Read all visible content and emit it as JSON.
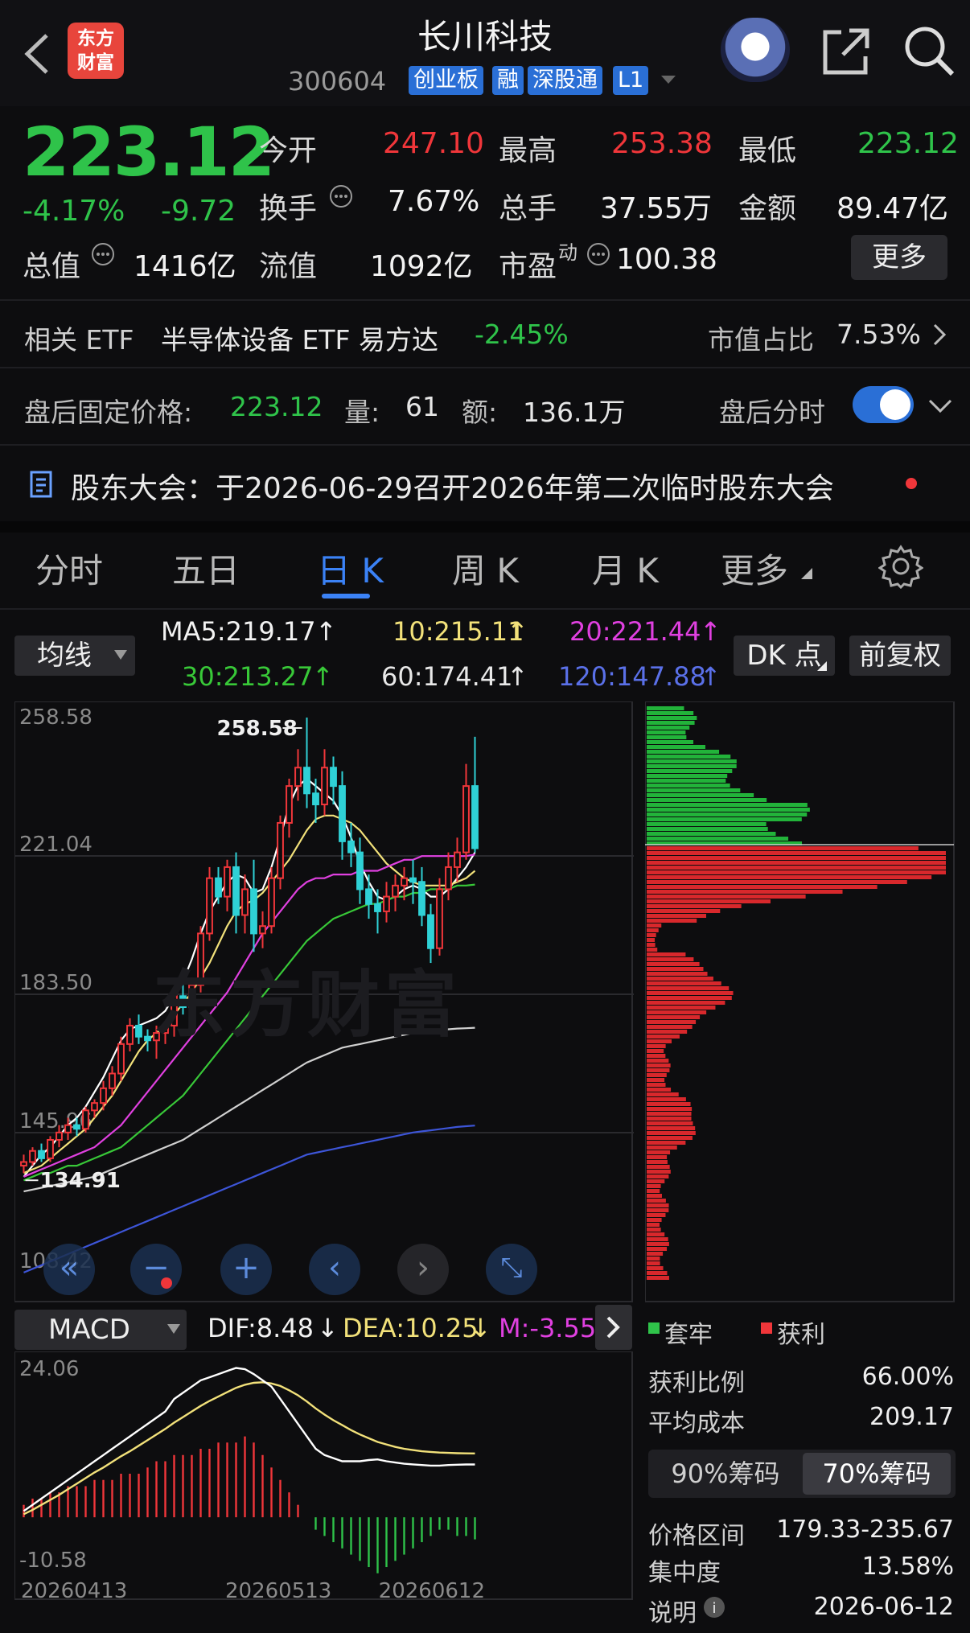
{
  "header": {
    "logo_text_line1": "东方",
    "logo_text_line2": "财富",
    "stock_name": "长川科技",
    "stock_code": "300604",
    "tags": [
      "创业板",
      "融",
      "深股通",
      "L1"
    ]
  },
  "quote": {
    "price": "223.12",
    "change_pct": "-4.17%",
    "change_abs": "-9.72",
    "open_label": "今开",
    "open": "247.10",
    "high_label": "最高",
    "high": "253.38",
    "low_label": "最低",
    "low": "223.12",
    "turnover_label": "换手",
    "turnover": "7.67%",
    "volume_label": "总手",
    "volume": "37.55万",
    "amount_label": "金额",
    "amount": "89.47亿",
    "mktcap_label": "总值",
    "mktcap": "1416亿",
    "float_label": "流值",
    "float": "1092亿",
    "pe_label": "市盈",
    "pe_sup": "动",
    "pe": "100.38",
    "more_label": "更多"
  },
  "etf": {
    "label": "相关 ETF",
    "name": "半导体设备 ETF 易方达",
    "change": "-2.45%",
    "ratio_label": "市值占比",
    "ratio": "7.53%"
  },
  "after_hours": {
    "price_label": "盘后固定价格:",
    "price": "223.12",
    "vol_label": "量:",
    "vol": "61",
    "amt_label": "额:",
    "amt": "136.1万",
    "toggle_label": "盘后分时"
  },
  "notice": {
    "text": "股东大会：于2026-06-29召开2026年第二次临时股东大会"
  },
  "tabs": [
    "分时",
    "五日",
    "日 K",
    "周 K",
    "月 K",
    "更多"
  ],
  "ma_bar": {
    "selector": "均线",
    "ma5": "MA5:219.17",
    "ma10": "10:215.11",
    "ma20": "20:221.44",
    "ma30": "30:213.27",
    "ma60": "60:174.41",
    "ma120": "120:147.88",
    "dk_label": "DK 点",
    "adjust_label": "前复权"
  },
  "colors": {
    "up": "#f0363a",
    "down": "#2fd1d6",
    "ma5": "#ffffff",
    "ma10": "#f2e17a",
    "ma20": "#e040e0",
    "ma30": "#38c838",
    "ma60": "#d0d0d0",
    "ma120": "#3d55d8",
    "accent": "#3b82f6"
  },
  "chart_data": {
    "type": "candlestick",
    "watermark": "东方财富",
    "y_axis_labels": [
      "258.58",
      "221.04",
      "183.50",
      "145.96",
      "108.42"
    ],
    "ylim": [
      108.42,
      258.58
    ],
    "max_marker": "258.58",
    "min_marker": "134.91",
    "x_labels": [
      "20260413",
      "20260513",
      "20260612"
    ],
    "candles": [
      [
        137,
        138,
        135,
        140
      ],
      [
        138,
        141,
        137,
        142
      ],
      [
        141,
        139,
        138,
        143
      ],
      [
        139,
        144,
        138,
        145
      ],
      [
        144,
        146,
        142,
        148
      ],
      [
        146,
        148,
        144,
        150
      ],
      [
        148,
        147,
        145,
        150
      ],
      [
        147,
        152,
        146,
        153
      ],
      [
        152,
        154,
        150,
        155
      ],
      [
        154,
        158,
        152,
        160
      ],
      [
        158,
        162,
        156,
        164
      ],
      [
        162,
        170,
        160,
        172
      ],
      [
        170,
        175,
        168,
        177
      ],
      [
        175,
        172,
        170,
        178
      ],
      [
        172,
        171,
        168,
        174
      ],
      [
        171,
        173,
        166,
        175
      ],
      [
        173,
        175,
        170,
        176
      ],
      [
        175,
        183,
        172,
        184
      ],
      [
        183,
        180,
        178,
        186
      ],
      [
        180,
        186,
        178,
        188
      ],
      [
        186,
        200,
        184,
        202
      ],
      [
        200,
        215,
        198,
        218
      ],
      [
        215,
        210,
        208,
        218
      ],
      [
        210,
        218,
        206,
        220
      ],
      [
        218,
        205,
        200,
        222
      ],
      [
        205,
        212,
        200,
        216
      ],
      [
        212,
        200,
        195,
        220
      ],
      [
        200,
        202,
        196,
        206
      ],
      [
        202,
        215,
        200,
        218
      ],
      [
        215,
        230,
        212,
        232
      ],
      [
        230,
        240,
        226,
        242
      ],
      [
        240,
        245,
        236,
        250
      ],
      [
        245,
        238,
        234,
        258.58
      ],
      [
        238,
        235,
        230,
        242
      ],
      [
        235,
        245,
        232,
        250
      ],
      [
        245,
        240,
        235,
        248
      ],
      [
        240,
        225,
        220,
        244
      ],
      [
        225,
        222,
        218,
        230
      ],
      [
        222,
        212,
        208,
        226
      ],
      [
        212,
        208,
        204,
        216
      ],
      [
        208,
        206,
        200,
        212
      ],
      [
        206,
        210,
        203,
        214
      ],
      [
        210,
        213,
        206,
        216
      ],
      [
        213,
        215,
        209,
        218
      ],
      [
        215,
        214,
        208,
        220
      ],
      [
        214,
        205,
        202,
        218
      ],
      [
        205,
        196,
        192,
        208
      ],
      [
        196,
        212,
        194,
        215
      ],
      [
        212,
        218,
        209,
        222
      ],
      [
        218,
        222,
        214,
        226
      ],
      [
        222,
        240,
        220,
        246
      ],
      [
        240,
        223.12,
        222,
        253.38
      ]
    ],
    "ma": {
      "MA5": [
        134,
        137,
        140,
        142,
        145,
        148,
        150,
        153,
        157,
        161,
        166,
        171,
        174,
        175,
        176,
        177,
        179,
        183,
        187,
        193,
        200,
        206,
        210,
        214,
        216,
        215,
        211,
        212,
        218,
        226,
        235,
        240,
        242,
        240,
        238,
        236,
        232,
        226,
        219,
        214,
        210,
        209,
        210,
        212,
        213,
        212,
        210,
        210,
        212,
        215,
        218,
        222
      ],
      "MA10": [
        135,
        136,
        137,
        139,
        141,
        143,
        145,
        147,
        150,
        153,
        156,
        160,
        164,
        168,
        171,
        173,
        175,
        178,
        181,
        184,
        188,
        192,
        197,
        202,
        206,
        208,
        209,
        211,
        214,
        217,
        220,
        224,
        228,
        231,
        232,
        232,
        231,
        230,
        228,
        225,
        222,
        219,
        217,
        215,
        214,
        213,
        213,
        213,
        213,
        214,
        215,
        217
      ],
      "MA20": [
        134,
        135,
        136,
        137,
        138,
        139,
        140,
        141,
        142,
        144,
        146,
        148,
        151,
        154,
        157,
        160,
        163,
        166,
        169,
        172,
        175,
        178,
        181,
        184,
        188,
        192,
        196,
        200,
        203,
        206,
        209,
        212,
        214,
        215,
        215,
        216,
        216,
        216,
        217,
        217,
        217,
        218,
        219,
        220,
        220,
        221,
        221,
        221,
        221,
        221,
        221,
        221.44
      ],
      "MA30": [
        133,
        134,
        135,
        135,
        136,
        137,
        137,
        138,
        139,
        140,
        141,
        142,
        144,
        146,
        148,
        150,
        152,
        154,
        156,
        159,
        162,
        165,
        168,
        171,
        174,
        177,
        180,
        183,
        186,
        189,
        192,
        195,
        198,
        200,
        202,
        204,
        205,
        206,
        207,
        208,
        208,
        209,
        210,
        210,
        211,
        211,
        212,
        212,
        212,
        213,
        213,
        213.27
      ],
      "MA60": [
        130,
        130.5,
        131,
        131.5,
        132,
        132.5,
        133,
        133.5,
        134,
        135,
        136,
        137,
        138,
        139,
        140,
        141,
        142,
        143,
        144,
        145.5,
        147,
        148.5,
        150,
        151.5,
        153,
        154.5,
        156,
        157.5,
        159,
        160.5,
        162,
        163.5,
        165,
        166,
        167,
        168,
        169,
        169.5,
        170,
        170.5,
        171,
        171.5,
        172,
        172.5,
        173,
        173.3,
        173.6,
        173.8,
        174,
        174.2,
        174.3,
        174.41
      ],
      "MA120": [
        108,
        109,
        110,
        111,
        112,
        113,
        114,
        115,
        116,
        117,
        118,
        119,
        120,
        121,
        122,
        123,
        124,
        125,
        126,
        127,
        128,
        129,
        130,
        131,
        132,
        133,
        134,
        135,
        136,
        137,
        138,
        139,
        140,
        140.5,
        141,
        141.5,
        142,
        142.5,
        143,
        143.5,
        144,
        144.5,
        145,
        145.5,
        146,
        146.3,
        146.6,
        146.9,
        147.2,
        147.5,
        147.7,
        147.88
      ]
    }
  },
  "macd": {
    "selector": "MACD",
    "dif": "DIF:8.48",
    "dea": "DEA:10.25",
    "m": "M:-3.55",
    "ylim": [
      -10.58,
      24.06
    ],
    "y_top": "24.06",
    "y_bottom": "-10.58",
    "hist": [
      2,
      3,
      3,
      4,
      4,
      5,
      5,
      5,
      6,
      6,
      6,
      7,
      7,
      7,
      8,
      9,
      9,
      10,
      10,
      10,
      11,
      11,
      12,
      12,
      12,
      13,
      12,
      10,
      8,
      6,
      4,
      2,
      0,
      -2,
      -3,
      -4,
      -5,
      -6,
      -7,
      -8,
      -9,
      -8,
      -7,
      -6,
      -5,
      -4,
      -3,
      -2,
      -2,
      -3,
      -3,
      -3.55
    ],
    "dif_line": [
      1,
      2,
      3,
      4,
      5,
      6,
      7,
      8,
      9,
      10,
      11,
      12,
      13,
      14,
      15,
      16,
      17,
      19,
      20,
      21,
      22,
      22.5,
      23,
      23.5,
      24,
      23.8,
      23,
      22,
      21,
      19,
      17,
      15,
      13,
      11,
      10,
      9.5,
      9,
      9,
      9,
      9.2,
      9.3,
      9,
      8.8,
      8.6,
      8.5,
      8.4,
      8.3,
      8.3,
      8.4,
      8.45,
      8.48,
      8.48
    ],
    "dea_line": [
      0.5,
      1.2,
      2,
      2.8,
      3.6,
      4.5,
      5.4,
      6.3,
      7.2,
      8,
      8.9,
      9.8,
      10.6,
      11.5,
      12.4,
      13.3,
      14.2,
      15.2,
      16.1,
      17,
      17.9,
      18.7,
      19.4,
      20.1,
      20.8,
      21.3,
      21.6,
      21.7,
      21.5,
      21.1,
      20.4,
      19.6,
      18.6,
      17.5,
      16.5,
      15.6,
      14.8,
      14,
      13.3,
      12.7,
      12.1,
      11.7,
      11.3,
      11,
      10.8,
      10.6,
      10.5,
      10.4,
      10.35,
      10.3,
      10.27,
      10.25
    ]
  },
  "chips": {
    "legend_trapped": "套牢",
    "legend_profit": "获利",
    "profit_ratio_label": "获利比例",
    "profit_ratio": "66.00%",
    "avg_cost_label": "平均成本",
    "avg_cost": "209.17",
    "btn_90": "90%筹码",
    "btn_70": "70%筹码",
    "range_label": "价格区间",
    "range": "179.33-235.67",
    "concentration_label": "集中度",
    "concentration": "13.58%",
    "note_label": "说明",
    "date": "2026-06-12"
  }
}
